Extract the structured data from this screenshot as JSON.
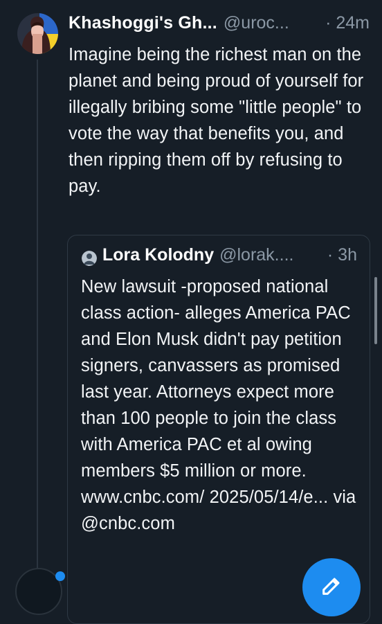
{
  "post": {
    "author_name": "Khashoggi's Gh...",
    "handle": "@uroc...",
    "time": "· 24m",
    "text": "Imagine being the richest man on the planet and being proud of yourself for illegally bribing some \"little people\" to vote the way that benefits you, and then ripping them off by refusing to pay."
  },
  "quote": {
    "author_name": "Lora Kolodny",
    "handle": "@lorak....",
    "time": "· 3h",
    "text": "New lawsuit -proposed national class action- alleges America PAC and Elon Musk didn't pay petition signers, canvassers as promised last year. Attorneys expect more than 100 people to join the class with America PAC et al owing members $5 million or more. www.cnbc.com/ 2025/05/14/e... via @cnbc.com"
  },
  "icons": {
    "avatar": "avatar",
    "quote_avatar": "quote-avatar",
    "compose": "compose-pen-icon"
  },
  "colors": {
    "background": "#161e27",
    "accent": "#1d8cf0",
    "secondary_text": "#8b98a5"
  }
}
